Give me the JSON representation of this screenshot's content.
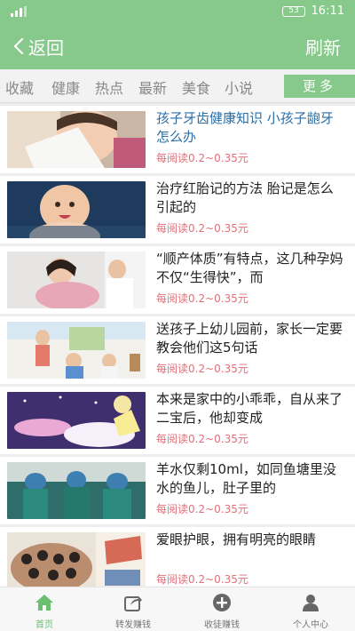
{
  "status_bar": {
    "time": "16:11",
    "battery": "53"
  },
  "header": {
    "back_label": "返回",
    "refresh_label": "刷新"
  },
  "tabs": {
    "items": [
      "收藏",
      "健康",
      "热点",
      "最新",
      "美食",
      "小说"
    ],
    "more_label": "更多"
  },
  "articles": [
    {
      "title": "孩子牙齿健康知识 小孩子龅牙怎么办",
      "reward": "每阅读0.2~0.35元",
      "title_color": "#2a6ea5"
    },
    {
      "title": "治疗红胎记的方法 胎记是怎么引起的",
      "reward": "每阅读0.2~0.35元"
    },
    {
      "title": "“顺产体质”有特点，这几种孕妈不仅“生得快”，而",
      "reward": "每阅读0.2~0.35元"
    },
    {
      "title": "送孩子上幼儿园前，家长一定要教会他们这5句话",
      "reward": "每阅读0.2~0.35元"
    },
    {
      "title": "本来是家中的小乖乖，自从来了二宝后，他却变成",
      "reward": "每阅读0.2~0.35元"
    },
    {
      "title": "羊水仅剩10ml，如同鱼塘里没水的鱼儿，肚子里的",
      "reward": "每阅读0.2~0.35元"
    },
    {
      "title": "爱眼护眼，拥有明亮的眼睛",
      "reward": "每阅读0.2~0.35元"
    }
  ],
  "bottom_nav": [
    {
      "label": "首页",
      "icon": "home-icon",
      "active": true
    },
    {
      "label": "转发赚钱",
      "icon": "share-icon"
    },
    {
      "label": "收徒赚钱",
      "icon": "add-circle-icon"
    },
    {
      "label": "个人中心",
      "icon": "person-icon"
    }
  ],
  "colors": {
    "accent": "#86c98a",
    "reward": "#e0707a",
    "title_link": "#2a6ea5"
  }
}
